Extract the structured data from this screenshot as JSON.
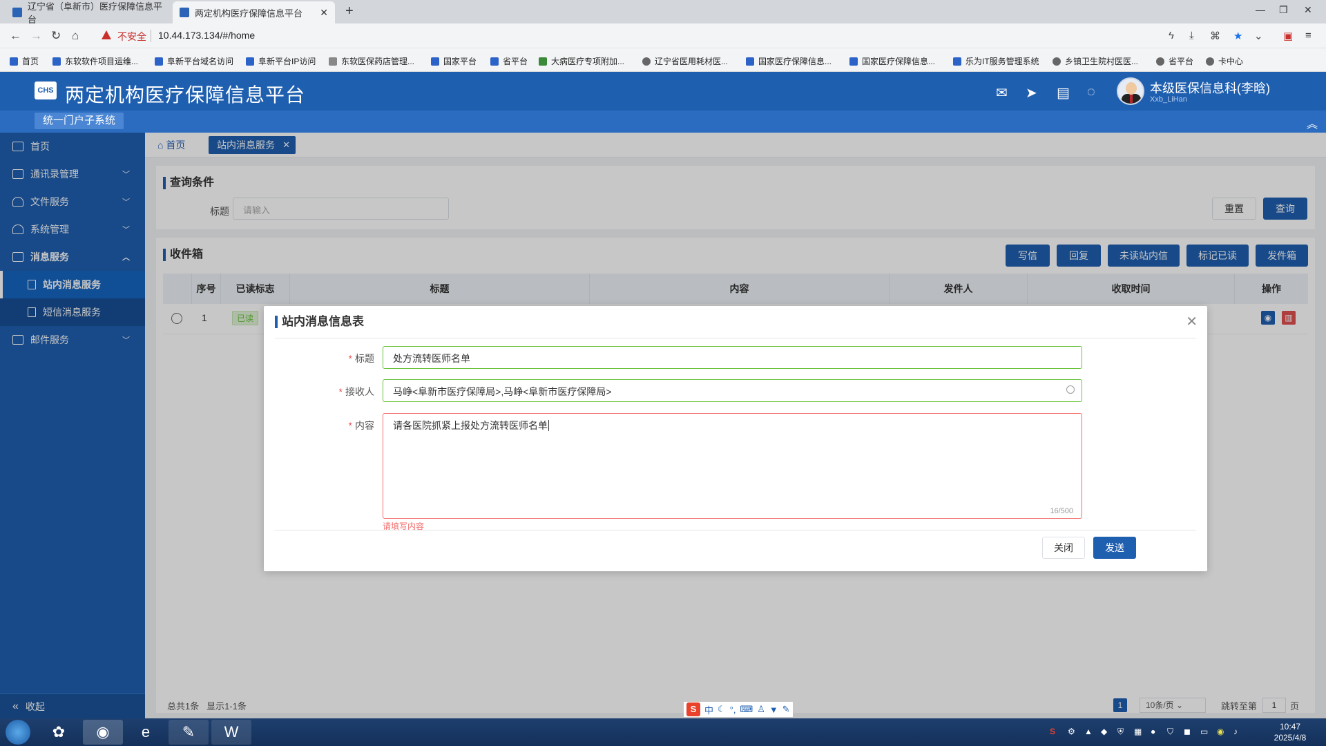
{
  "browser": {
    "tabs": [
      {
        "title": "辽宁省（阜新市）医疗保障信息平台"
      },
      {
        "title": "两定机构医疗保障信息平台"
      }
    ],
    "insecure_label": "不安全",
    "url": "10.44.173.134/#/home",
    "bookmarks": [
      "首页",
      "东软软件项目运维...",
      "阜新平台域名访问",
      "阜新平台IP访问",
      "东软医保药店管理...",
      "国家平台",
      "省平台",
      "大病医疗专项附加...",
      "辽宁省医用耗材医...",
      "国家医疗保障信息...",
      "国家医疗保障信息...",
      "乐为IT服务管理系统",
      "乡镇卫生院村医医...",
      "省平台",
      "卡中心"
    ]
  },
  "app": {
    "title": "两定机构医疗保障信息平台",
    "logo_text": "CHS",
    "portal": "统一门户子系统",
    "user_name": "本级医保信息科(李晗)",
    "user_sub": "Xxb_LiHan"
  },
  "sidebar": {
    "items": [
      {
        "label": "首页"
      },
      {
        "label": "通讯录管理"
      },
      {
        "label": "文件服务"
      },
      {
        "label": "系统管理"
      },
      {
        "label": "消息服务"
      },
      {
        "label": "邮件服务"
      }
    ],
    "sub_items": [
      {
        "label": "站内消息服务"
      },
      {
        "label": "短信消息服务"
      }
    ],
    "collapse": "收起"
  },
  "page_tabs": {
    "home": "首页",
    "active": "站内消息服务"
  },
  "query": {
    "title": "查询条件",
    "label": "标题",
    "placeholder": "请输入",
    "reset": "重置",
    "search": "查询"
  },
  "inbox": {
    "title": "收件箱",
    "buttons": [
      "写信",
      "回复",
      "未读站内信",
      "标记已读",
      "发件箱"
    ],
    "columns": [
      "序号",
      "已读标志",
      "标题",
      "内容",
      "发件人",
      "收取时间",
      "操作"
    ],
    "row": {
      "index": "1",
      "read_flag": "已读"
    },
    "total": "总共1条",
    "showing": "显示1-1条",
    "page_current": "1",
    "page_size": "10条/页",
    "jump_label": "跳转至第",
    "jump_value": "1",
    "page_unit": "页"
  },
  "modal": {
    "title": "站内消息信息表",
    "fields": {
      "title_label": "标题",
      "title_value": "处方流转医师名单",
      "recipient_label": "接收人",
      "recipient_value": "马峥<阜新市医疗保障局>,马峥<阜新市医疗保障局>",
      "content_label": "内容",
      "content_value": "请各医院抓紧上报处方流转医师名单",
      "counter": "16/500",
      "error": "请填写内容"
    },
    "close_btn": "关闭",
    "send_btn": "发送"
  },
  "taskbar": {
    "time": "10:47",
    "date": "2025/4/8"
  },
  "ime": {
    "label": "中"
  }
}
